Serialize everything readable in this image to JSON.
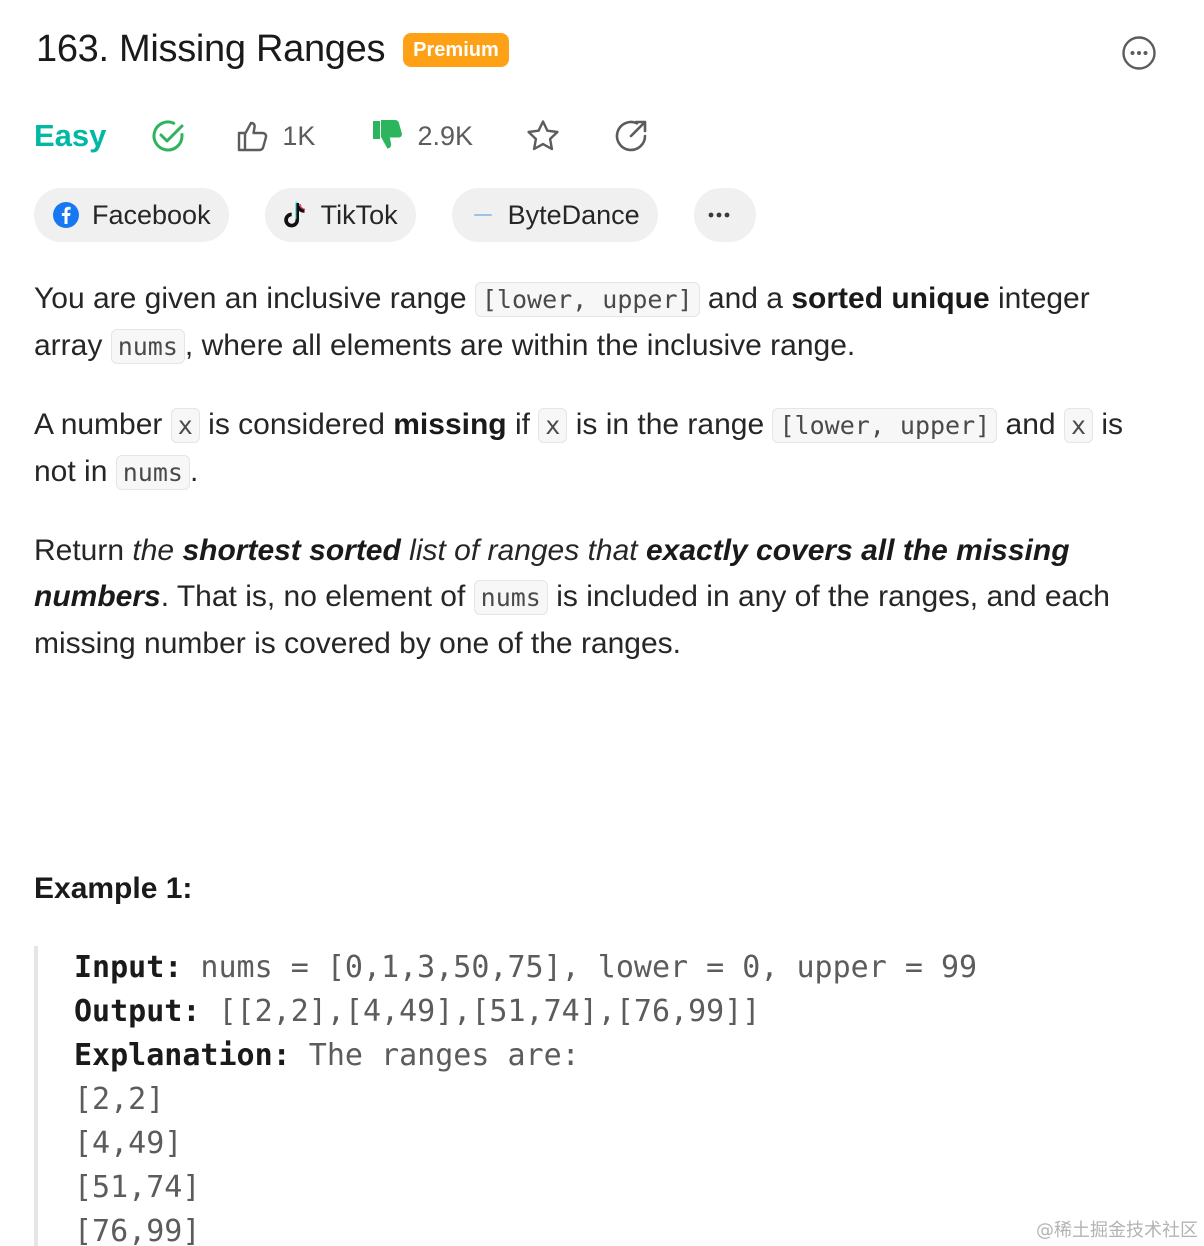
{
  "problem": {
    "title": "163. Missing Ranges",
    "premium_badge": "Premium",
    "difficulty": "Easy",
    "likes": "1K",
    "dislikes": "2.9K"
  },
  "companies": [
    {
      "name": "Facebook",
      "icon": "facebook-icon"
    },
    {
      "name": "TikTok",
      "icon": "tiktok-icon"
    },
    {
      "name": "ByteDance",
      "icon": "bytedance-icon"
    }
  ],
  "description": {
    "p1": {
      "t1": "You are given an inclusive range ",
      "code1": "[lower, upper]",
      "t2": " and a ",
      "b1": "sorted unique",
      "t3": " integer array ",
      "code2": "nums",
      "t4": ", where all elements are within the inclusive range."
    },
    "p2": {
      "t1": "A number ",
      "code1": "x",
      "t2": " is considered ",
      "b1": "missing",
      "t3": " if ",
      "code2": "x",
      "t4": " is in the range ",
      "code3": "[lower, upper]",
      "t5": " and ",
      "code4": "x",
      "t6": " is not in ",
      "code5": "nums",
      "t7": "."
    },
    "p3": {
      "t1": "Return ",
      "i1": "the ",
      "bi1": "shortest sorted",
      "i2": " list of ranges that ",
      "bi2": "exactly covers all the missing numbers",
      "t2": ". That is, no element of ",
      "code1": "nums",
      "t3": " is included in any of the ranges, and each missing number is covered by one of the ranges."
    }
  },
  "example1": {
    "title": "Example 1:",
    "input_label": "Input:",
    "input_value": " nums = [0,1,3,50,75], lower = 0, upper = 99",
    "output_label": "Output:",
    "output_value": " [[2,2],[4,49],[51,74],[76,99]]",
    "explanation_label": "Explanation:",
    "explanation_value": " The ranges are:",
    "ranges": [
      "[2,2]",
      "[4,49]",
      "[51,74]",
      "[76,99]"
    ]
  },
  "watermark": "@稀土掘金技术社区",
  "colors": {
    "easy": "#00b8a3",
    "premium": "#ffa116",
    "dislike": "#2db55d",
    "facebook": "#1877f2"
  }
}
